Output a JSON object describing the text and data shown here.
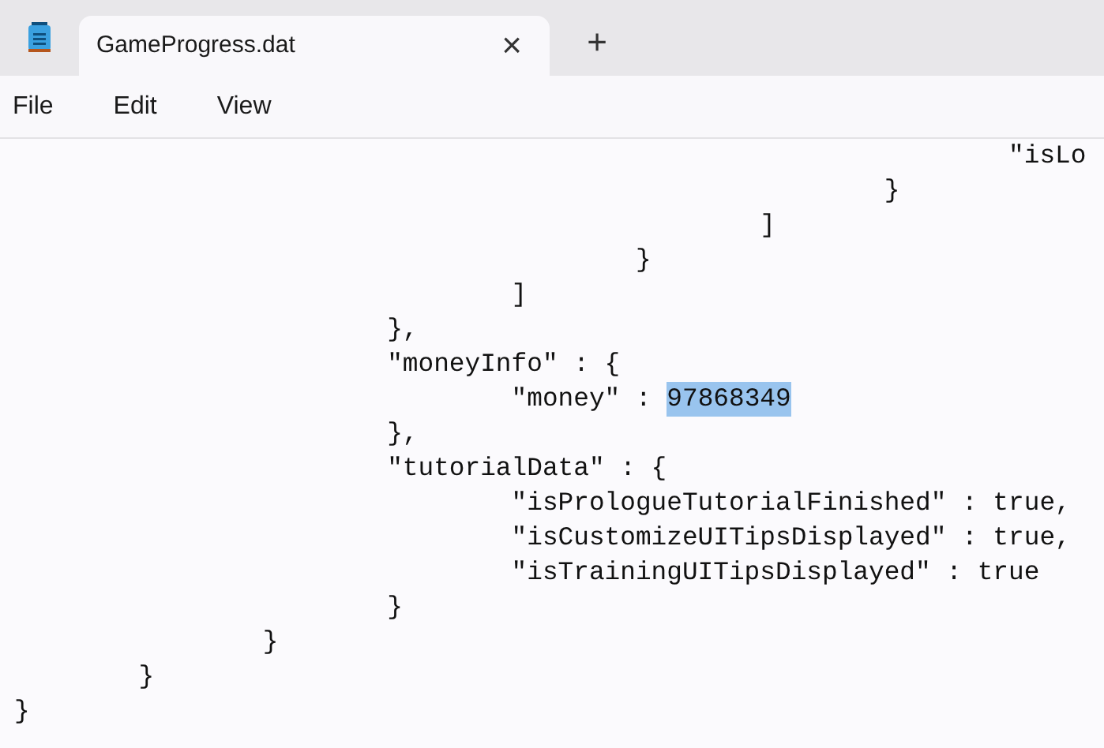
{
  "tabs": [
    {
      "title": "GameProgress.dat",
      "selected": true,
      "close": "×"
    }
  ],
  "new_tab": "+",
  "menu": [
    "File",
    "Edit",
    "View"
  ],
  "lines": [
    {
      "text": "\t\t\t\t\t\t\t\t\"isLo"
    },
    {
      "text": "\t\t\t\t\t\t\t}"
    },
    {
      "text": "\t\t\t\t\t\t]"
    },
    {
      "text": "\t\t\t\t\t}"
    },
    {
      "text": "\t\t\t\t]"
    },
    {
      "text": "\t\t\t},"
    },
    {
      "text": "\t\t\t\"moneyInfo\" : {"
    },
    {
      "text": "\t\t\t\t\"money\" : ",
      "selected_text": "97868349"
    },
    {
      "text": "\t\t\t},"
    },
    {
      "text": "\t\t\t\"tutorialData\" : {"
    },
    {
      "text": "\t\t\t\t\"isPrologueTutorialFinished\" : true,"
    },
    {
      "text": "\t\t\t\t\"isCustomizeUITipsDisplayed\" : true,"
    },
    {
      "text": "\t\t\t\t\"isTrainingUITipsDisplayed\" : true"
    },
    {
      "text": "\t\t\t}"
    },
    {
      "text": "\t\t}"
    },
    {
      "text": "\t}"
    },
    {
      "text": "}"
    }
  ]
}
